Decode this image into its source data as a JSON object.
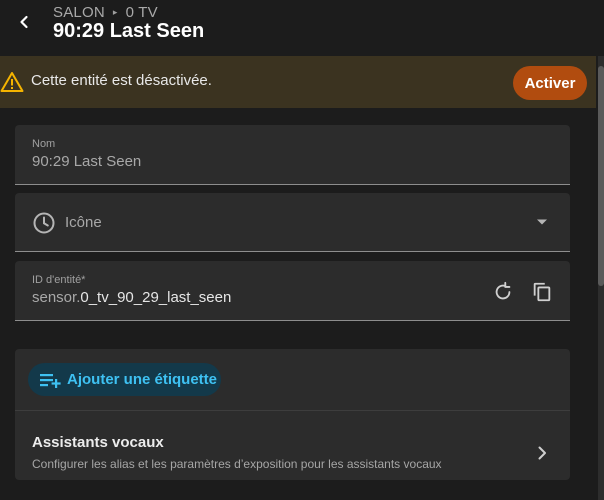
{
  "header": {
    "breadcrumb": [
      "SALON",
      "0 TV"
    ],
    "breadcrumb_separator": "▸",
    "title": "90:29 Last Seen"
  },
  "banner": {
    "message": "Cette entité est désactivée.",
    "action_label": "Activer",
    "icon": "warning-icon"
  },
  "form": {
    "name": {
      "label": "Nom",
      "value": "90:29 Last Seen"
    },
    "icon": {
      "placeholder": "Icône",
      "icon": "clock-icon"
    },
    "entity_id": {
      "label": "ID d'entité*",
      "prefix": "sensor.",
      "value": "0_tv_90_29_last_seen"
    }
  },
  "labels": {
    "add_label": "Ajouter une étiquette"
  },
  "voice_assistants": {
    "title": "Assistants vocaux",
    "subtitle": "Configurer les alias et les paramètres d’exposition pour les assistants vocaux"
  },
  "colors": {
    "background": "#1c1c1c",
    "banner_bg": "#3b3320",
    "warning": "#f5b400",
    "activate_button": "#b14c0f",
    "accent": "#3ec1f2",
    "field_bg": "#2c2c2c"
  }
}
